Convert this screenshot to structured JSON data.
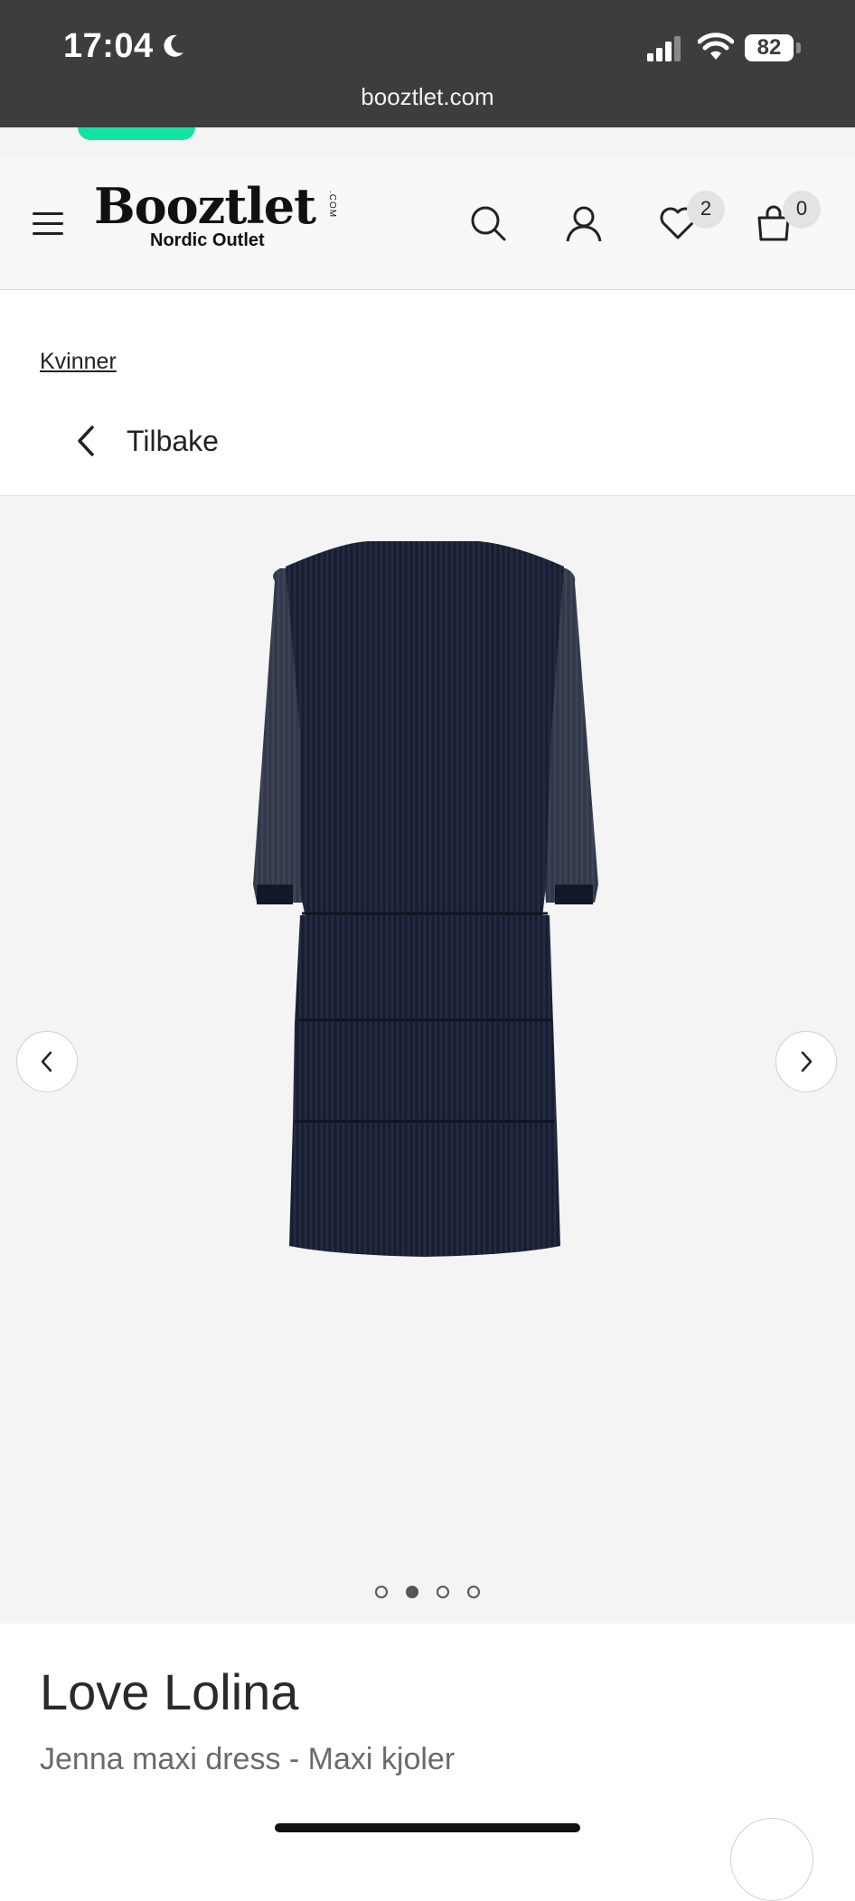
{
  "status_bar": {
    "time": "17:04",
    "battery": "82"
  },
  "browser": {
    "url": "booztlet.com"
  },
  "header": {
    "logo": "Booztlet",
    "logo_suffix": ".COM",
    "logo_tagline": "Nordic Outlet",
    "wishlist_count": "2",
    "cart_count": "0"
  },
  "breadcrumb": {
    "label": "Kvinner"
  },
  "back": {
    "label": "Tilbake"
  },
  "gallery": {
    "image_count": 4,
    "active_index": 1
  },
  "product": {
    "brand": "Love Lolina",
    "name": "Jenna maxi dress - Maxi kjoler"
  },
  "colors": {
    "accent_green": "#12e3a5",
    "dress": "#1c2235",
    "status_bar": "#3d3d3d"
  }
}
